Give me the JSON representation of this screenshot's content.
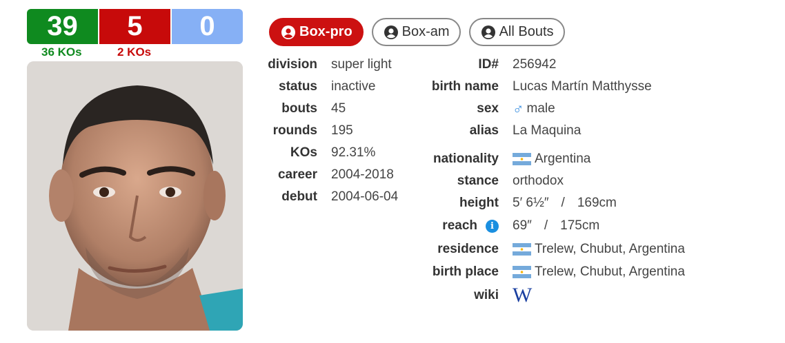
{
  "colors": {
    "win": "#0f8a1f",
    "loss": "#c70a0a",
    "draw": "#86b0f5",
    "accent": "#cc1111"
  },
  "record": {
    "wins": "39",
    "losses": "5",
    "draws": "0",
    "win_kos": "36 KOs",
    "loss_kos": "2 KOs"
  },
  "tabs": [
    {
      "label": "Box-pro",
      "active": true,
      "icon": "user-circle-icon"
    },
    {
      "label": "Box-am",
      "active": false,
      "icon": "user-circle-icon"
    },
    {
      "label": "All Bouts",
      "active": false,
      "icon": "user-circle-icon"
    }
  ],
  "left_info": [
    {
      "label": "division",
      "value": "super light"
    },
    {
      "label": "status",
      "value": "inactive"
    },
    {
      "label": "bouts",
      "value": "45"
    },
    {
      "label": "rounds",
      "value": "195"
    },
    {
      "label": "KOs",
      "value": "92.31%"
    },
    {
      "label": "career",
      "value": "2004-2018"
    },
    {
      "label": "debut",
      "value": "2004-06-04"
    }
  ],
  "right_info": {
    "id": {
      "label": "ID#",
      "value": "256942"
    },
    "birth_name": {
      "label": "birth name",
      "value": "Lucas Martín Matthysse"
    },
    "sex": {
      "label": "sex",
      "value": "male",
      "icon": "male-symbol-icon"
    },
    "alias": {
      "label": "alias",
      "value": "La Maquina"
    },
    "nationality": {
      "label": "nationality",
      "value": "Argentina",
      "icon": "argentina-flag-icon"
    },
    "stance": {
      "label": "stance",
      "value": "orthodox"
    },
    "height": {
      "label": "height",
      "imperial": "5′ 6½″",
      "sep": "/",
      "metric": "169cm"
    },
    "reach": {
      "label": "reach",
      "imperial": "69″",
      "sep": "/",
      "metric": "175cm",
      "icon": "info-icon"
    },
    "residence": {
      "label": "residence",
      "value": "Trelew, Chubut, Argentina",
      "icon": "argentina-flag-icon"
    },
    "birth_place": {
      "label": "birth place",
      "value": "Trelew, Chubut, Argentina",
      "icon": "argentina-flag-icon"
    },
    "wiki": {
      "label": "wiki",
      "icon": "wikipedia-icon",
      "glyph": "W"
    }
  }
}
